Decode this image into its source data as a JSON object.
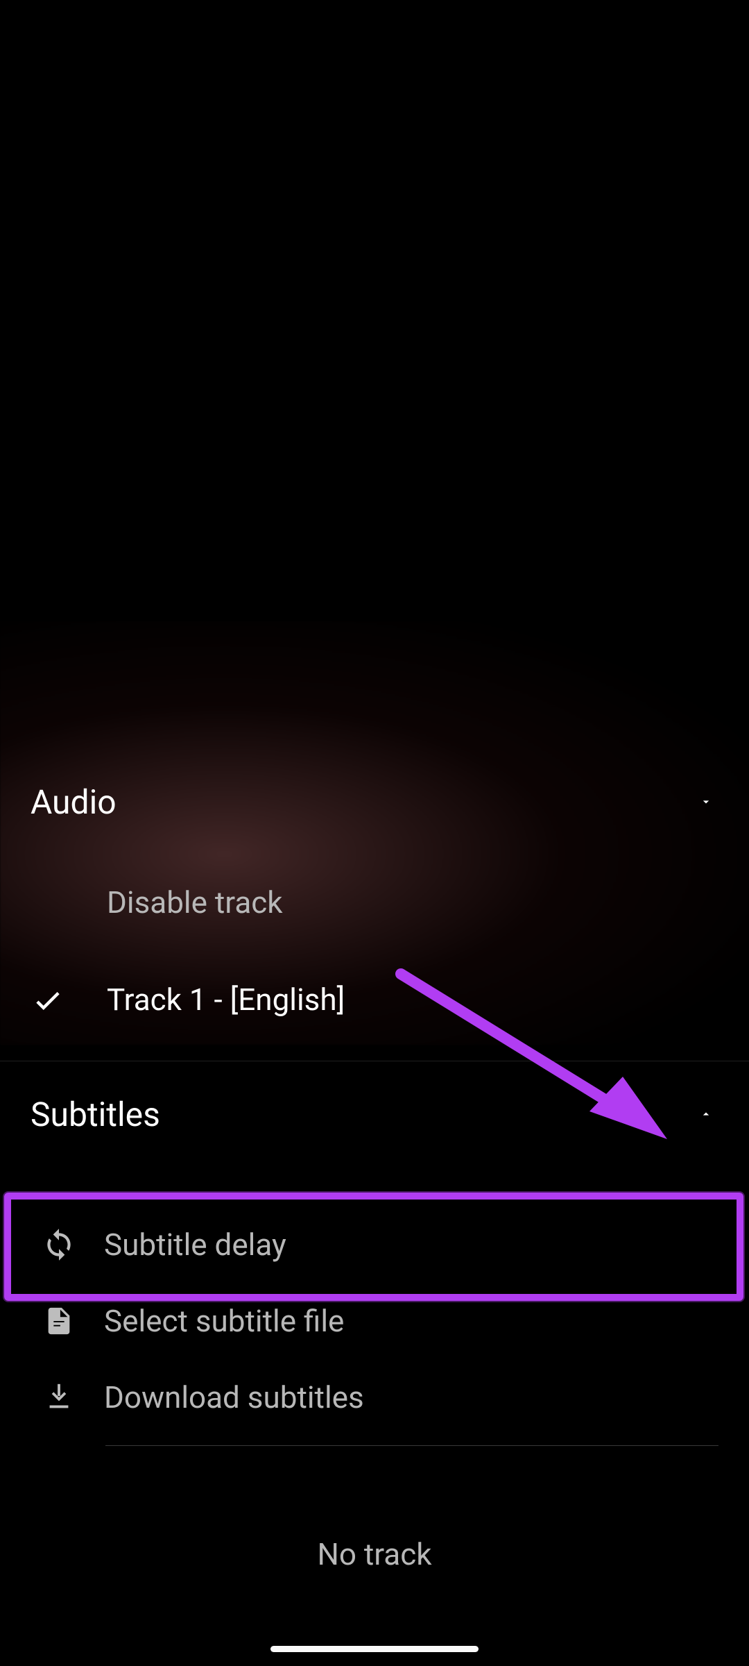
{
  "annotation": {
    "highlight_color": "#b13df2",
    "arrow_color": "#b13df2"
  },
  "audio": {
    "section_label": "Audio",
    "collapsed": false,
    "items": [
      {
        "label": "Disable track",
        "selected": false
      },
      {
        "label": "Track 1 - [English]",
        "selected": true
      }
    ]
  },
  "subtitles": {
    "section_label": "Subtitles",
    "collapsed": false,
    "actions": [
      {
        "icon": "sync-icon",
        "label": "Subtitle delay"
      },
      {
        "icon": "file-icon",
        "label": "Select subtitle file"
      },
      {
        "icon": "download-icon",
        "label": "Download subtitles"
      }
    ],
    "empty_label": "No track"
  }
}
